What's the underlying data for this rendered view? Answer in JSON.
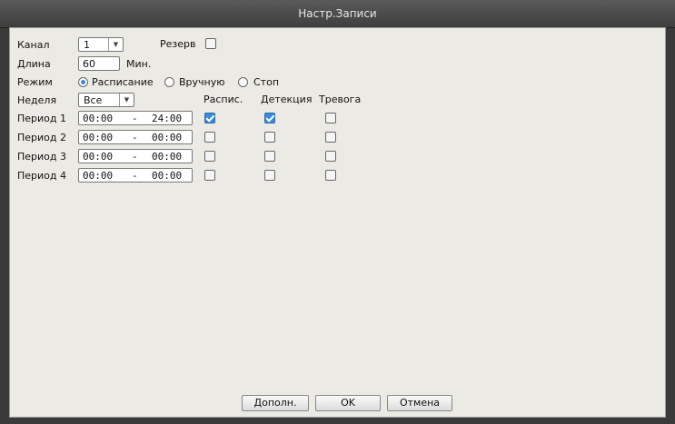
{
  "window": {
    "title": "Настр.Записи"
  },
  "channel": {
    "label": "Канал",
    "value": "1"
  },
  "reserve": {
    "label": "Резерв",
    "checked": false
  },
  "length": {
    "label": "Длина",
    "value": "60",
    "unit": "Мин."
  },
  "mode": {
    "label": "Режим",
    "options": [
      {
        "label": "Расписание",
        "selected": true
      },
      {
        "label": "Вручную",
        "selected": false
      },
      {
        "label": "Стоп",
        "selected": false
      }
    ]
  },
  "week": {
    "label": "Неделя",
    "value": "Все"
  },
  "columns": {
    "schedule": "Распис.",
    "detection": "Детекция",
    "alarm": "Тревога"
  },
  "periods": [
    {
      "label": "Период 1",
      "start": "00:00",
      "sep": "-",
      "end": "24:00",
      "schedule": true,
      "detection": true,
      "alarm": false
    },
    {
      "label": "Период 2",
      "start": "00:00",
      "sep": "-",
      "end": "00:00",
      "schedule": false,
      "detection": false,
      "alarm": false
    },
    {
      "label": "Период 3",
      "start": "00:00",
      "sep": "-",
      "end": "00:00",
      "schedule": false,
      "detection": false,
      "alarm": false
    },
    {
      "label": "Период 4",
      "start": "00:00",
      "sep": "-",
      "end": "00:00",
      "schedule": false,
      "detection": false,
      "alarm": false
    }
  ],
  "buttons": {
    "more": "Дополн.",
    "ok": "OK",
    "cancel": "Отмена"
  },
  "colors": {
    "accent": "#3d8bd8",
    "panel": "#eceae4",
    "titlebar": "#4a4a4a"
  }
}
